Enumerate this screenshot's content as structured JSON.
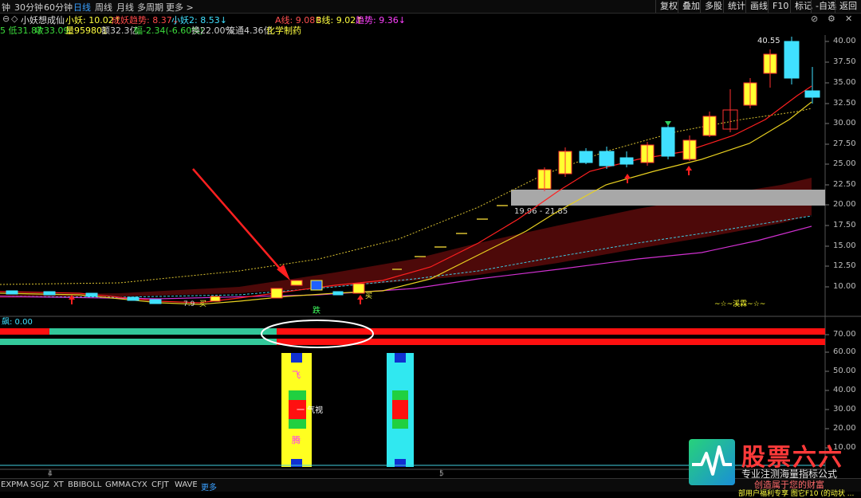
{
  "top_tabs": [
    {
      "label": "钟",
      "active": false
    },
    {
      "label": "30分钟",
      "active": false
    },
    {
      "label": "60分钟",
      "active": false
    },
    {
      "label": "日线",
      "active": true
    },
    {
      "label": "周线",
      "active": false
    },
    {
      "label": "月线",
      "active": false
    },
    {
      "label": "多周期",
      "active": false
    },
    {
      "label": "更多 >",
      "active": false
    }
  ],
  "top_buttons": [
    "复权",
    "叠加",
    "多股",
    "统计",
    "画线",
    "F10",
    "标记",
    "-自选",
    "返回"
  ],
  "info1": {
    "stock_name": "小妖想成仙",
    "items": [
      {
        "text": "小妖: 10.02↑",
        "color": "#ffff40"
      },
      {
        "text": "成妖趋势: 8.37↓",
        "color": "#ff4a4a"
      },
      {
        "text": "小妖2: 8.53↓",
        "color": "#40e0ff"
      },
      {
        "text": "A线: 9.08↑",
        "color": "#ff5050"
      },
      {
        "text": "B线: 9.02↑",
        "color": "#ffff40"
      },
      {
        "text": "趋势: 9.36↓",
        "color": "#ff40ff"
      }
    ]
  },
  "info2": {
    "items": [
      {
        "text": "5 低31.87",
        "color": "#3cdc3c"
      },
      {
        "text": "收33.09",
        "color": "#3cdc3c"
      },
      {
        "text": "量959801",
        "color": "#ffff40"
      },
      {
        "text": "额32.3亿",
        "color": "#d0d0d0"
      },
      {
        "text": "幅-2.34(-6.60%)",
        "color": "#3cdc3c"
      },
      {
        "text": "换22.00%",
        "color": "#d0d0d0"
      },
      {
        "text": "流通4.36亿",
        "color": "#d0d0d0"
      },
      {
        "text": "化学制药",
        "color": "#ffff40"
      }
    ]
  },
  "main_axis": {
    "ticks": [
      "40.00",
      "37.50",
      "35.00",
      "32.50",
      "30.00",
      "27.50",
      "25.00",
      "22.50",
      "20.00",
      "17.50",
      "15.00",
      "12.50",
      "10.00"
    ]
  },
  "sub_axis": {
    "ticks": [
      "70.00",
      "60.00",
      "50.00",
      "40.00",
      "30.00",
      "20.00",
      "10.00"
    ]
  },
  "annotations": {
    "peak_label": "40.55",
    "support_label": "19.96 - 21.85",
    "low_label": "7.9",
    "buy_label_1": "买",
    "buy_label_2": "买",
    "sell_label": "跌",
    "signature": "~☆~溪霖~☆~",
    "sub_title": "飙: 0.00",
    "qi_label": "一 气视",
    "bar_top_char": "飞",
    "bar_bottom_char": "腾"
  },
  "x_labels": [
    "4",
    "5"
  ],
  "bottom_tabs": [
    {
      "label": "EXPMA",
      "active": false
    },
    {
      "label": "SGJZ",
      "active": false
    },
    {
      "label": "XT",
      "active": false
    },
    {
      "label": "BBIBOLL",
      "active": false
    },
    {
      "label": "GMMA",
      "active": false
    },
    {
      "label": "CYX",
      "active": false
    },
    {
      "label": "CFJT",
      "active": false
    },
    {
      "label": "WAVE",
      "active": false
    },
    {
      "label": "更多",
      "active": true
    }
  ],
  "logo": {
    "title": "股票六六",
    "line1": "专业注测海量指标公式",
    "line2": "创造属于您的财富",
    "tail_text": "部用户福利专享 图它F10 (的动状 ..."
  },
  "colors": {
    "up": "#ff2020",
    "down": "#40e0ff",
    "yellow": "#ffff30",
    "teal": "#33c89a"
  }
}
